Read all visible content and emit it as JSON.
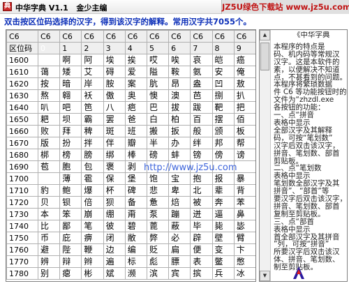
{
  "window": {
    "icon_text": "典",
    "title": "中华字典 V1.1   金少主编",
    "brand_text": "JZ5U绿色下载站 www.jz5u.com"
  },
  "instruction": "双击按区位码选择的汉字，得到该汉字的解释。常用汉字共7055个。",
  "grid": {
    "header_cells": [
      "C6",
      "C6",
      "C6",
      "C6",
      "C6",
      "C6",
      "C6",
      "C6",
      "C6",
      "C6",
      "C6"
    ],
    "index_row": {
      "label": "区位码",
      "digits": [
        "0",
        "1",
        "2",
        "3",
        "4",
        "5",
        "6",
        "7",
        "8",
        "9"
      ]
    },
    "rows": [
      {
        "code": "1600",
        "chars": [
          "",
          "啊",
          "阿",
          "埃",
          "挨",
          "哎",
          "唉",
          "哀",
          "皑",
          "癌"
        ]
      },
      {
        "code": "1610",
        "chars": [
          "蔼",
          "矮",
          "艾",
          "碍",
          "爱",
          "隘",
          "鞍",
          "氨",
          "安",
          "俺"
        ]
      },
      {
        "code": "1620",
        "chars": [
          "按",
          "暗",
          "岸",
          "胺",
          "案",
          "肮",
          "昂",
          "盎",
          "凹",
          "敖"
        ]
      },
      {
        "code": "1630",
        "chars": [
          "熬",
          "翱",
          "袄",
          "傲",
          "奥",
          "懊",
          "澳",
          "芭",
          "捌",
          "扒"
        ]
      },
      {
        "code": "1640",
        "chars": [
          "叭",
          "吧",
          "笆",
          "八",
          "疤",
          "巴",
          "拔",
          "跋",
          "靶",
          "把"
        ]
      },
      {
        "code": "1650",
        "chars": [
          "耙",
          "坝",
          "霸",
          "罢",
          "爸",
          "白",
          "柏",
          "百",
          "摆",
          "佰"
        ]
      },
      {
        "code": "1660",
        "chars": [
          "败",
          "拜",
          "稗",
          "斑",
          "班",
          "搬",
          "扳",
          "般",
          "颁",
          "板"
        ]
      },
      {
        "code": "1670",
        "chars": [
          "版",
          "扮",
          "拌",
          "伴",
          "瓣",
          "半",
          "办",
          "绊",
          "邦",
          "帮"
        ]
      },
      {
        "code": "1680",
        "chars": [
          "梆",
          "榜",
          "膀",
          "绑",
          "棒",
          "磅",
          "蚌",
          "镑",
          "傍",
          "谤"
        ]
      },
      {
        "code": "1690",
        "chars": [
          "苞",
          "胞",
          "包",
          "褒",
          "剥",
          "",
          "",
          "",
          "",
          ""
        ]
      },
      {
        "code": "1700",
        "chars": [
          "",
          "薄",
          "雹",
          "保",
          "堡",
          "饱",
          "宝",
          "抱",
          "报",
          "暴"
        ]
      },
      {
        "code": "1710",
        "chars": [
          "豹",
          "鲍",
          "爆",
          "杯",
          "碑",
          "悲",
          "卑",
          "北",
          "辈",
          "背"
        ]
      },
      {
        "code": "1720",
        "chars": [
          "贝",
          "钡",
          "倍",
          "狈",
          "备",
          "惫",
          "焙",
          "被",
          "奔",
          "苯"
        ]
      },
      {
        "code": "1730",
        "chars": [
          "本",
          "笨",
          "崩",
          "绷",
          "甭",
          "泵",
          "蹦",
          "迸",
          "逼",
          "鼻"
        ]
      },
      {
        "code": "1740",
        "chars": [
          "比",
          "鄙",
          "笔",
          "彼",
          "碧",
          "蓖",
          "蔽",
          "毕",
          "毙",
          "毖"
        ]
      },
      {
        "code": "1750",
        "chars": [
          "币",
          "庇",
          "痹",
          "闭",
          "敝",
          "弊",
          "必",
          "辟",
          "壁",
          "臂"
        ]
      },
      {
        "code": "1760",
        "chars": [
          "避",
          "陛",
          "鞭",
          "边",
          "编",
          "贬",
          "扁",
          "便",
          "变",
          "卞"
        ]
      },
      {
        "code": "1770",
        "chars": [
          "辨",
          "辩",
          "辫",
          "遍",
          "标",
          "彪",
          "膘",
          "表",
          "鳖",
          "憋"
        ]
      },
      {
        "code": "1780",
        "chars": [
          "别",
          "瘪",
          "彬",
          "斌",
          "濒",
          "滨",
          "宾",
          "摈",
          "兵",
          "冰"
        ]
      }
    ]
  },
  "help_panel": {
    "title": "《中华字典",
    "lines": [
      "本程序的特点是",
      "码、机内码等常规汉",
      "汉字。这是本软件的",
      "素，以便解决不知道",
      "点，不甚看到的问题。",
      "    本程序将繁琐数据",
      "件 C6 等功能按钮时的",
      "文件为“zhzdl.exe",
      "各按钮的功能：",
      "    一、点“拼音",
      "        表格中显示",
      "全部汉字及其解释",
      "码，可按“笔划数”",
      "汉字后双击该汉字，",
      "拼音、笔划数、部首",
      "剪贴板。",
      "    二、点“笔划数",
      "        表格中显示",
      "笔划数全部汉字及其",
      "拼音”、“部首”等",
      "要汉字后双击该汉字，",
      "拼音、笔划数、部首",
      "复制至剪贴板。",
      "    三、点“部首",
      "        表格中显示",
      "首全部汉字及其拼音",
      "”列，可按“拼音”",
      "所要汉字后双击该汉",
      "体、拼音、笔划数、",
      "制至剪贴板。"
    ]
  },
  "watermark": "http://www.jz5u.com"
}
